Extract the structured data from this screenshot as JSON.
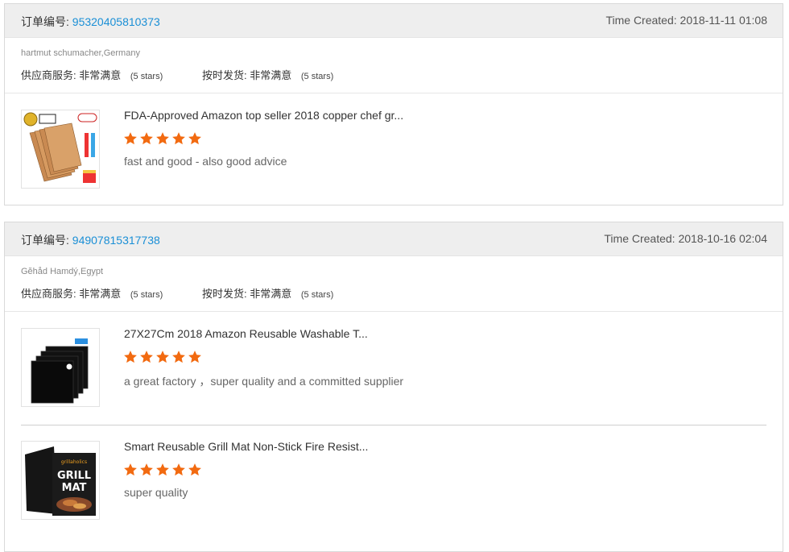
{
  "orders": [
    {
      "order_label": "订单编号:",
      "order_no": "95320405810373",
      "time_created": "Time Created: 2018-11-11 01:08",
      "buyer": "hartmut schumacher,Germany",
      "supplier_service_label": "供应商服务:",
      "supplier_service_value": "非常满意",
      "supplier_service_stars": "(5 stars)",
      "on_time_label": "按时发货:",
      "on_time_value": "非常满意",
      "on_time_stars": "(5 stars)",
      "items": [
        {
          "title": "FDA-Approved Amazon top seller 2018 copper chef gr...",
          "rating": 5,
          "comment": "fast and good - also good advice",
          "image": "copper-grill-mat-6pack-image"
        }
      ]
    },
    {
      "order_label": "订单编号:",
      "order_no": "94907815317738",
      "time_created": "Time Created: 2018-10-16 02:04",
      "buyer": "Gĕhåd Hamdý,Egypt",
      "supplier_service_label": "供应商服务:",
      "supplier_service_value": "非常满意",
      "supplier_service_stars": "(5 stars)",
      "on_time_label": "按时发货:",
      "on_time_value": "非常满意",
      "on_time_stars": "(5 stars)",
      "items": [
        {
          "title": "27X27Cm 2018 Amazon Reusable Washable T...",
          "rating": 5,
          "comment": "a great factory ，super quality  and a committed supplier",
          "image": "black-stove-liner-image"
        },
        {
          "title": "Smart Reusable Grill Mat Non-Stick Fire Resist...",
          "rating": 5,
          "comment": "super quality",
          "image": "grill-mat-box-image",
          "image_text": [
            "grillaholics",
            "GRILL",
            "MAT"
          ]
        }
      ]
    }
  ],
  "colors": {
    "link_blue": "#1a8fd6",
    "star_orange": "#f26a10",
    "header_bg": "#eeeeee"
  }
}
